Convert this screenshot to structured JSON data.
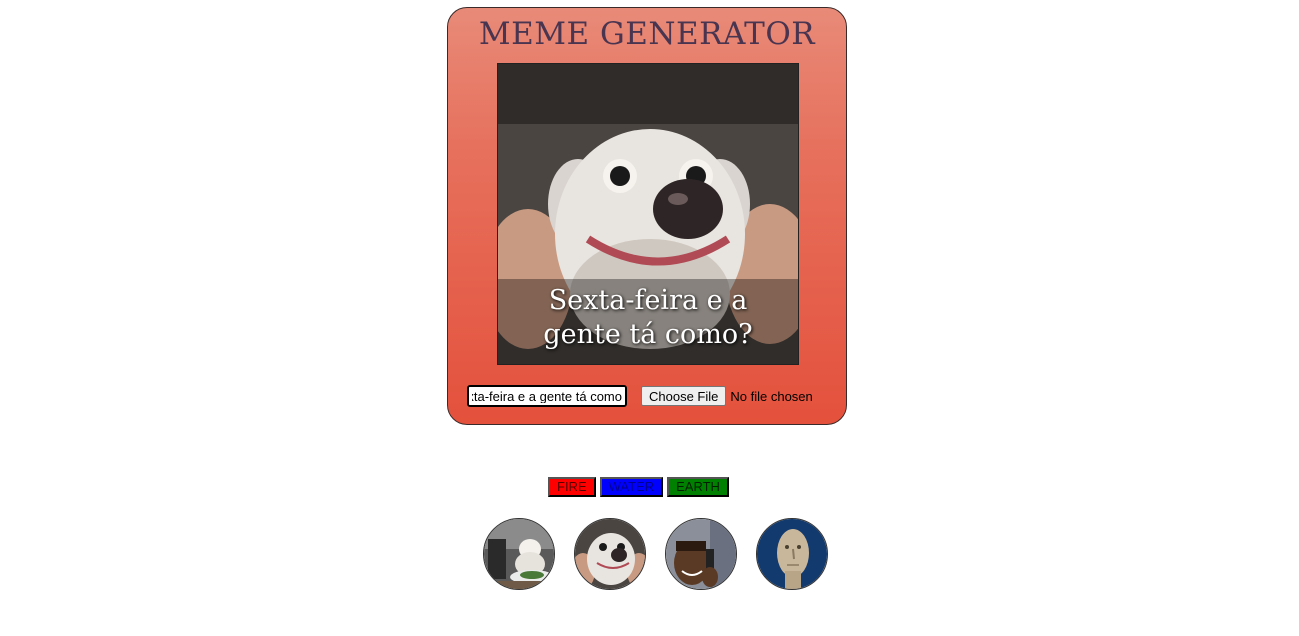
{
  "header": {
    "title": "MEME GENERATOR"
  },
  "meme": {
    "image_name": "smiling-dog-meme",
    "caption": "Sexta-feira e a gente tá como?"
  },
  "controls": {
    "text_input_value": "Sexta-feira e a gente tá como?",
    "file_button_label": "Choose File",
    "file_status": "No file chosen"
  },
  "themes": {
    "fire_label": "FIRE",
    "water_label": "WATER",
    "earth_label": "EARTH",
    "colors": {
      "fire": "#ff0000",
      "water": "#0000ff",
      "earth": "#008000"
    }
  },
  "thumbnails": [
    {
      "name": "woman-yelling-at-cat-thumbnail"
    },
    {
      "name": "smiling-dog-thumbnail"
    },
    {
      "name": "guy-on-phone-thumbnail"
    },
    {
      "name": "meme-man-thumbnail"
    }
  ],
  "colors": {
    "card_gradient_top": "#e88a78",
    "card_gradient_bottom": "#e4513c",
    "title": "#4a3550"
  }
}
